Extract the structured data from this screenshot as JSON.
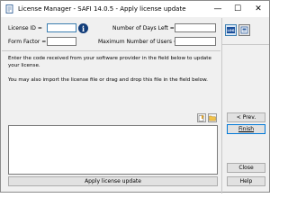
{
  "window": {
    "title": "License Manager - SAFI 14.0.5 - Apply license update",
    "minimize_glyph": "—",
    "maximize_glyph": "☐",
    "close_glyph": "✕"
  },
  "form": {
    "license_id_label": "License ID =",
    "form_factor_label": "Form Factor =",
    "days_left_label": "Number of Days Left =",
    "max_users_label": "Maximum Number of Users =",
    "license_id_value": "",
    "form_factor_value": "",
    "days_left_value": "",
    "max_users_value": "",
    "info_glyph": "i"
  },
  "description": {
    "line1": "Enter the code received from your software provider in the field below to update your license.",
    "line2": "You may also import the license file or drag and drop this file in the field below."
  },
  "license_text": {
    "value": ""
  },
  "sidebar": {
    "log_badge": "LOG",
    "prev_label": "< Prev.",
    "finish_label": "Finish",
    "close_label": "Close",
    "help_label": "Help"
  },
  "apply_button_label": "Apply license update",
  "icons": {
    "app": "license-manager-icon",
    "log": "log-icon",
    "tool": "tool-icon",
    "import_file": "import-file-icon",
    "open_folder": "open-folder-icon",
    "info": "info-icon"
  }
}
